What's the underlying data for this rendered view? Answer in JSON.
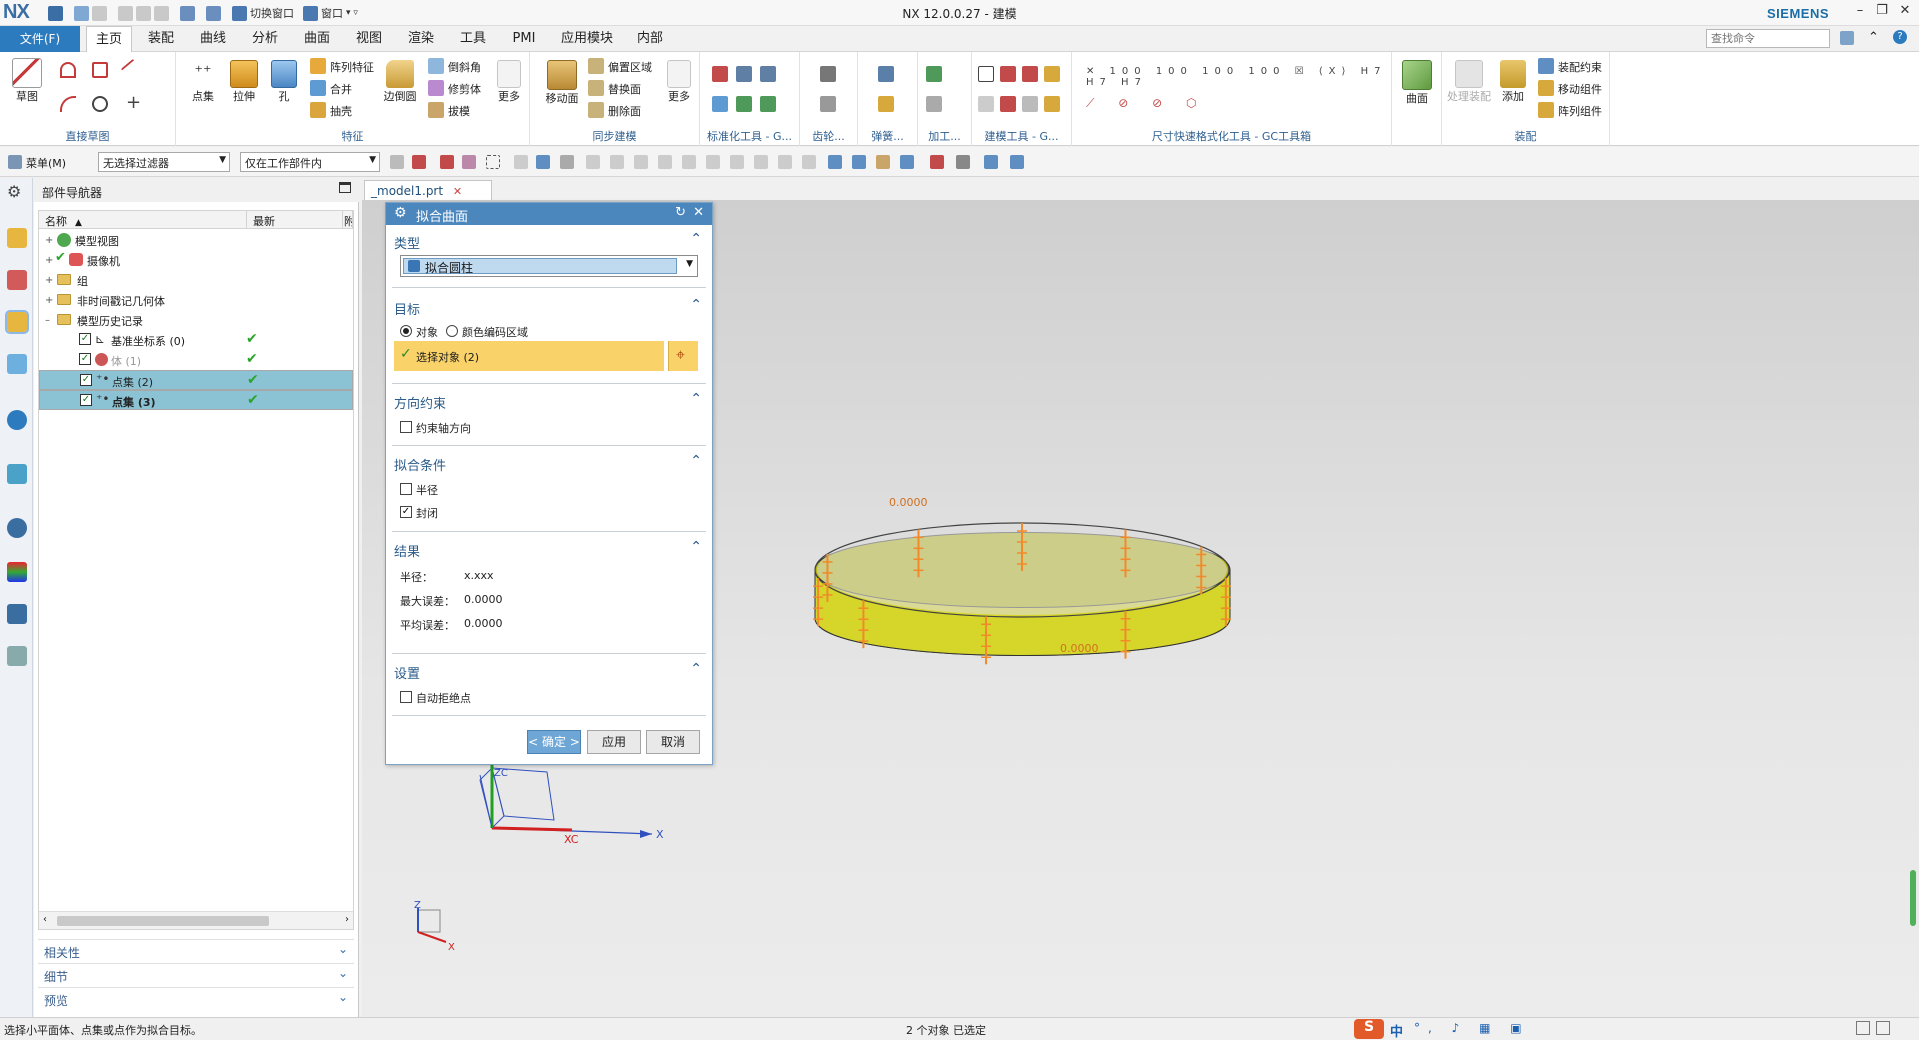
{
  "titlebar": {
    "logo": "NX",
    "title": "NX 12.0.0.27 - 建模",
    "switch_window": "切换窗口",
    "window_menu": "窗口",
    "brand": "SIEMENS"
  },
  "menubar": {
    "file": "文件(F)",
    "tabs": [
      "主页",
      "装配",
      "曲线",
      "分析",
      "曲面",
      "视图",
      "渲染",
      "工具",
      "PMI",
      "应用模块",
      "内部"
    ],
    "active_tab": "主页",
    "search_placeholder": "查找命令"
  },
  "ribbon": {
    "groups": {
      "direct_sketch": "直接草图",
      "feature": "特征",
      "sync": "同步建模",
      "std_parts": "标准化工具 - G...",
      "gear": "齿轮...",
      "spring": "弹簧...",
      "process": "加工...",
      "modeling_tools": "建模工具 - G...",
      "dim_tools": "尺寸快速格式化工具 - GC工具箱",
      "assembly": "装配"
    },
    "labels": {
      "sketch": "草图",
      "point_set": "点集",
      "extrude": "拉伸",
      "hole": "孔",
      "pattern_feature": "阵列特征",
      "unite": "合并",
      "shell": "抽壳",
      "edge_blend": "边倒圆",
      "chamfer": "倒斜角",
      "trim_body": "修剪体",
      "draft": "拔模",
      "more1": "更多",
      "move_face": "移动面",
      "offset_region": "偏置区域",
      "replace_face": "替换面",
      "delete_face": "删除面",
      "more2": "更多",
      "surface": "曲面",
      "process_assy": "处理装配",
      "add": "添加",
      "assy_constraint": "装配约束",
      "move_component": "移动组件",
      "pattern_component": "阵列组件"
    }
  },
  "toolbar2": {
    "menu": "菜单(M)",
    "filter": "无选择过滤器",
    "scope": "仅在工作部件内"
  },
  "navigator": {
    "title": "部件导航器",
    "col_name": "名称",
    "col_latest": "最新",
    "col_extra": "附",
    "rows": [
      {
        "label": "模型视图"
      },
      {
        "label": "摄像机"
      },
      {
        "label": "组"
      },
      {
        "label": "非时间戳记几何体"
      },
      {
        "label": "模型历史记录"
      },
      {
        "label": "基准坐标系 (0)"
      },
      {
        "label": "体 (1)"
      },
      {
        "label": "点集 (2)"
      },
      {
        "label": "点集 (3)"
      }
    ],
    "sections": [
      "相关性",
      "细节",
      "预览"
    ]
  },
  "document_tab": "_model1.prt",
  "dialog": {
    "title": "拟合曲面",
    "type_section": "类型",
    "type_value": "拟合圆柱",
    "target_section": "目标",
    "radio_object": "对象",
    "radio_color": "颜色编码区域",
    "select_object": "选择对象 (2)",
    "direction_section": "方向约束",
    "constrain_axis": "约束轴方向",
    "fit_section": "拟合条件",
    "radius": "半径",
    "closed": "封闭",
    "result_section": "结果",
    "result_radius_label": "半径：",
    "result_radius_value": "x.xxx",
    "max_err_label": "最大误差：",
    "max_err_value": "0.0000",
    "avg_err_label": "平均误差：",
    "avg_err_value": "0.0000",
    "settings_section": "设置",
    "auto_reject": "自动拒绝点",
    "ok": "< 确定 >",
    "apply": "应用",
    "cancel": "取消"
  },
  "viewport": {
    "dev_label_1": "0.0000",
    "dev_label_2": "0.0000",
    "axis_xc": "XC",
    "axis_x": "X",
    "axis_zc": "ZC",
    "triad_z": "Z",
    "triad_x": "X",
    "cylinder_color": "#c8c818",
    "marker_color": "#f08a2a"
  },
  "statusbar": {
    "left": "选择小平面体、点集或点作为拟合目标。",
    "center": "2 个对象 已选定",
    "ime": "中"
  }
}
